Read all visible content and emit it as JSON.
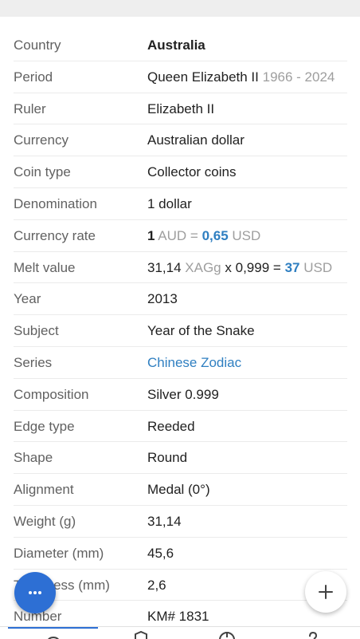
{
  "rows": [
    {
      "label": "Country",
      "value": "Australia"
    },
    {
      "label": "Period",
      "value": "Queen Elizabeth II",
      "extra": "1966 - 2024"
    },
    {
      "label": "Ruler",
      "value": "Elizabeth II"
    },
    {
      "label": "Currency",
      "value": "Australian dollar"
    },
    {
      "label": "Coin type",
      "value": "Collector coins"
    },
    {
      "label": "Denomination",
      "value": "1 dollar"
    },
    {
      "label": "Currency rate",
      "rate_amount": "1",
      "rate_from": "AUD",
      "rate_eq": "=",
      "rate_value": "0,65",
      "rate_to": "USD"
    },
    {
      "label": "Melt value",
      "melt_weight": "31,14",
      "melt_unit": "XAGg",
      "melt_x": "x",
      "melt_purity": "0,999",
      "melt_eq": "=",
      "melt_value": "37",
      "melt_currency": "USD"
    },
    {
      "label": "Year",
      "value": "2013"
    },
    {
      "label": "Subject",
      "value": "Year of the Snake"
    },
    {
      "label": "Series",
      "value": "Chinese Zodiac"
    },
    {
      "label": "Composition",
      "value": "Silver 0.999"
    },
    {
      "label": "Edge type",
      "value": "Reeded"
    },
    {
      "label": "Shape",
      "value": "Round"
    },
    {
      "label": "Alignment",
      "value": "Medal (0°)"
    },
    {
      "label": "Weight (g)",
      "value": "31,14"
    },
    {
      "label": "Diameter (mm)",
      "value": "45,6"
    },
    {
      "label": "Thickness (mm)",
      "value": "2,6"
    },
    {
      "label": "Number",
      "value": "KM# 1831"
    }
  ],
  "fab": {
    "menu_icon": "more-horizontal-icon",
    "add_icon": "plus-icon"
  },
  "bottom_nav": {
    "icons": [
      "coin-icon",
      "catalog-icon",
      "globe-icon",
      "help-icon"
    ]
  },
  "colors": {
    "accent": "#2d6fd4",
    "link": "#2f7fc1",
    "muted": "#9e9e9e",
    "label": "#616161"
  }
}
